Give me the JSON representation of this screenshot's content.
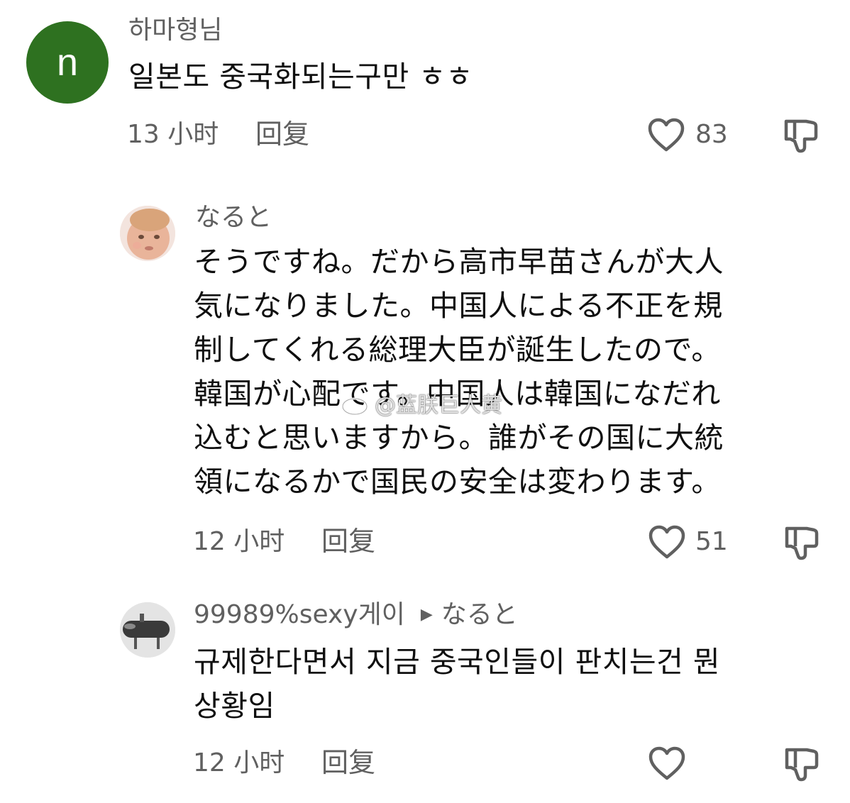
{
  "comments": [
    {
      "avatar_letter": "n",
      "avatar_color": "#2e7120",
      "author": "하마형님",
      "text": "일본도 중국화되는구만 ㅎㅎ",
      "time": "13 小时",
      "reply_label": "回复",
      "likes": "83"
    },
    {
      "author": "なると",
      "text_lines": [
        "そうですね。だから高市早苗さんが大人",
        "気になりました。中国人による不正を規",
        "制してくれる総理大臣が誕生したので。",
        "韓国が心配です。中国人は韓国になだれ",
        "込むと思いますから。誰がその国に大統",
        "領になるかで国民の安全は変わります。"
      ],
      "time": "12 小时",
      "reply_label": "回复",
      "likes": "51"
    },
    {
      "author": "99989%sexy게이",
      "reply_to": "なると",
      "text_lines": [
        "규제한다면서 지금 중국인들이 판치는건 뭔",
        "상황임"
      ],
      "time": "12 小时",
      "reply_label": "回复"
    }
  ],
  "watermark": "@蓝朕巨人黄",
  "icons": {
    "like": "heart-outline-icon",
    "dislike": "thumbs-down-icon",
    "reply_arrow": "triangle-right-icon",
    "watermark_logo": "weibo-icon"
  }
}
